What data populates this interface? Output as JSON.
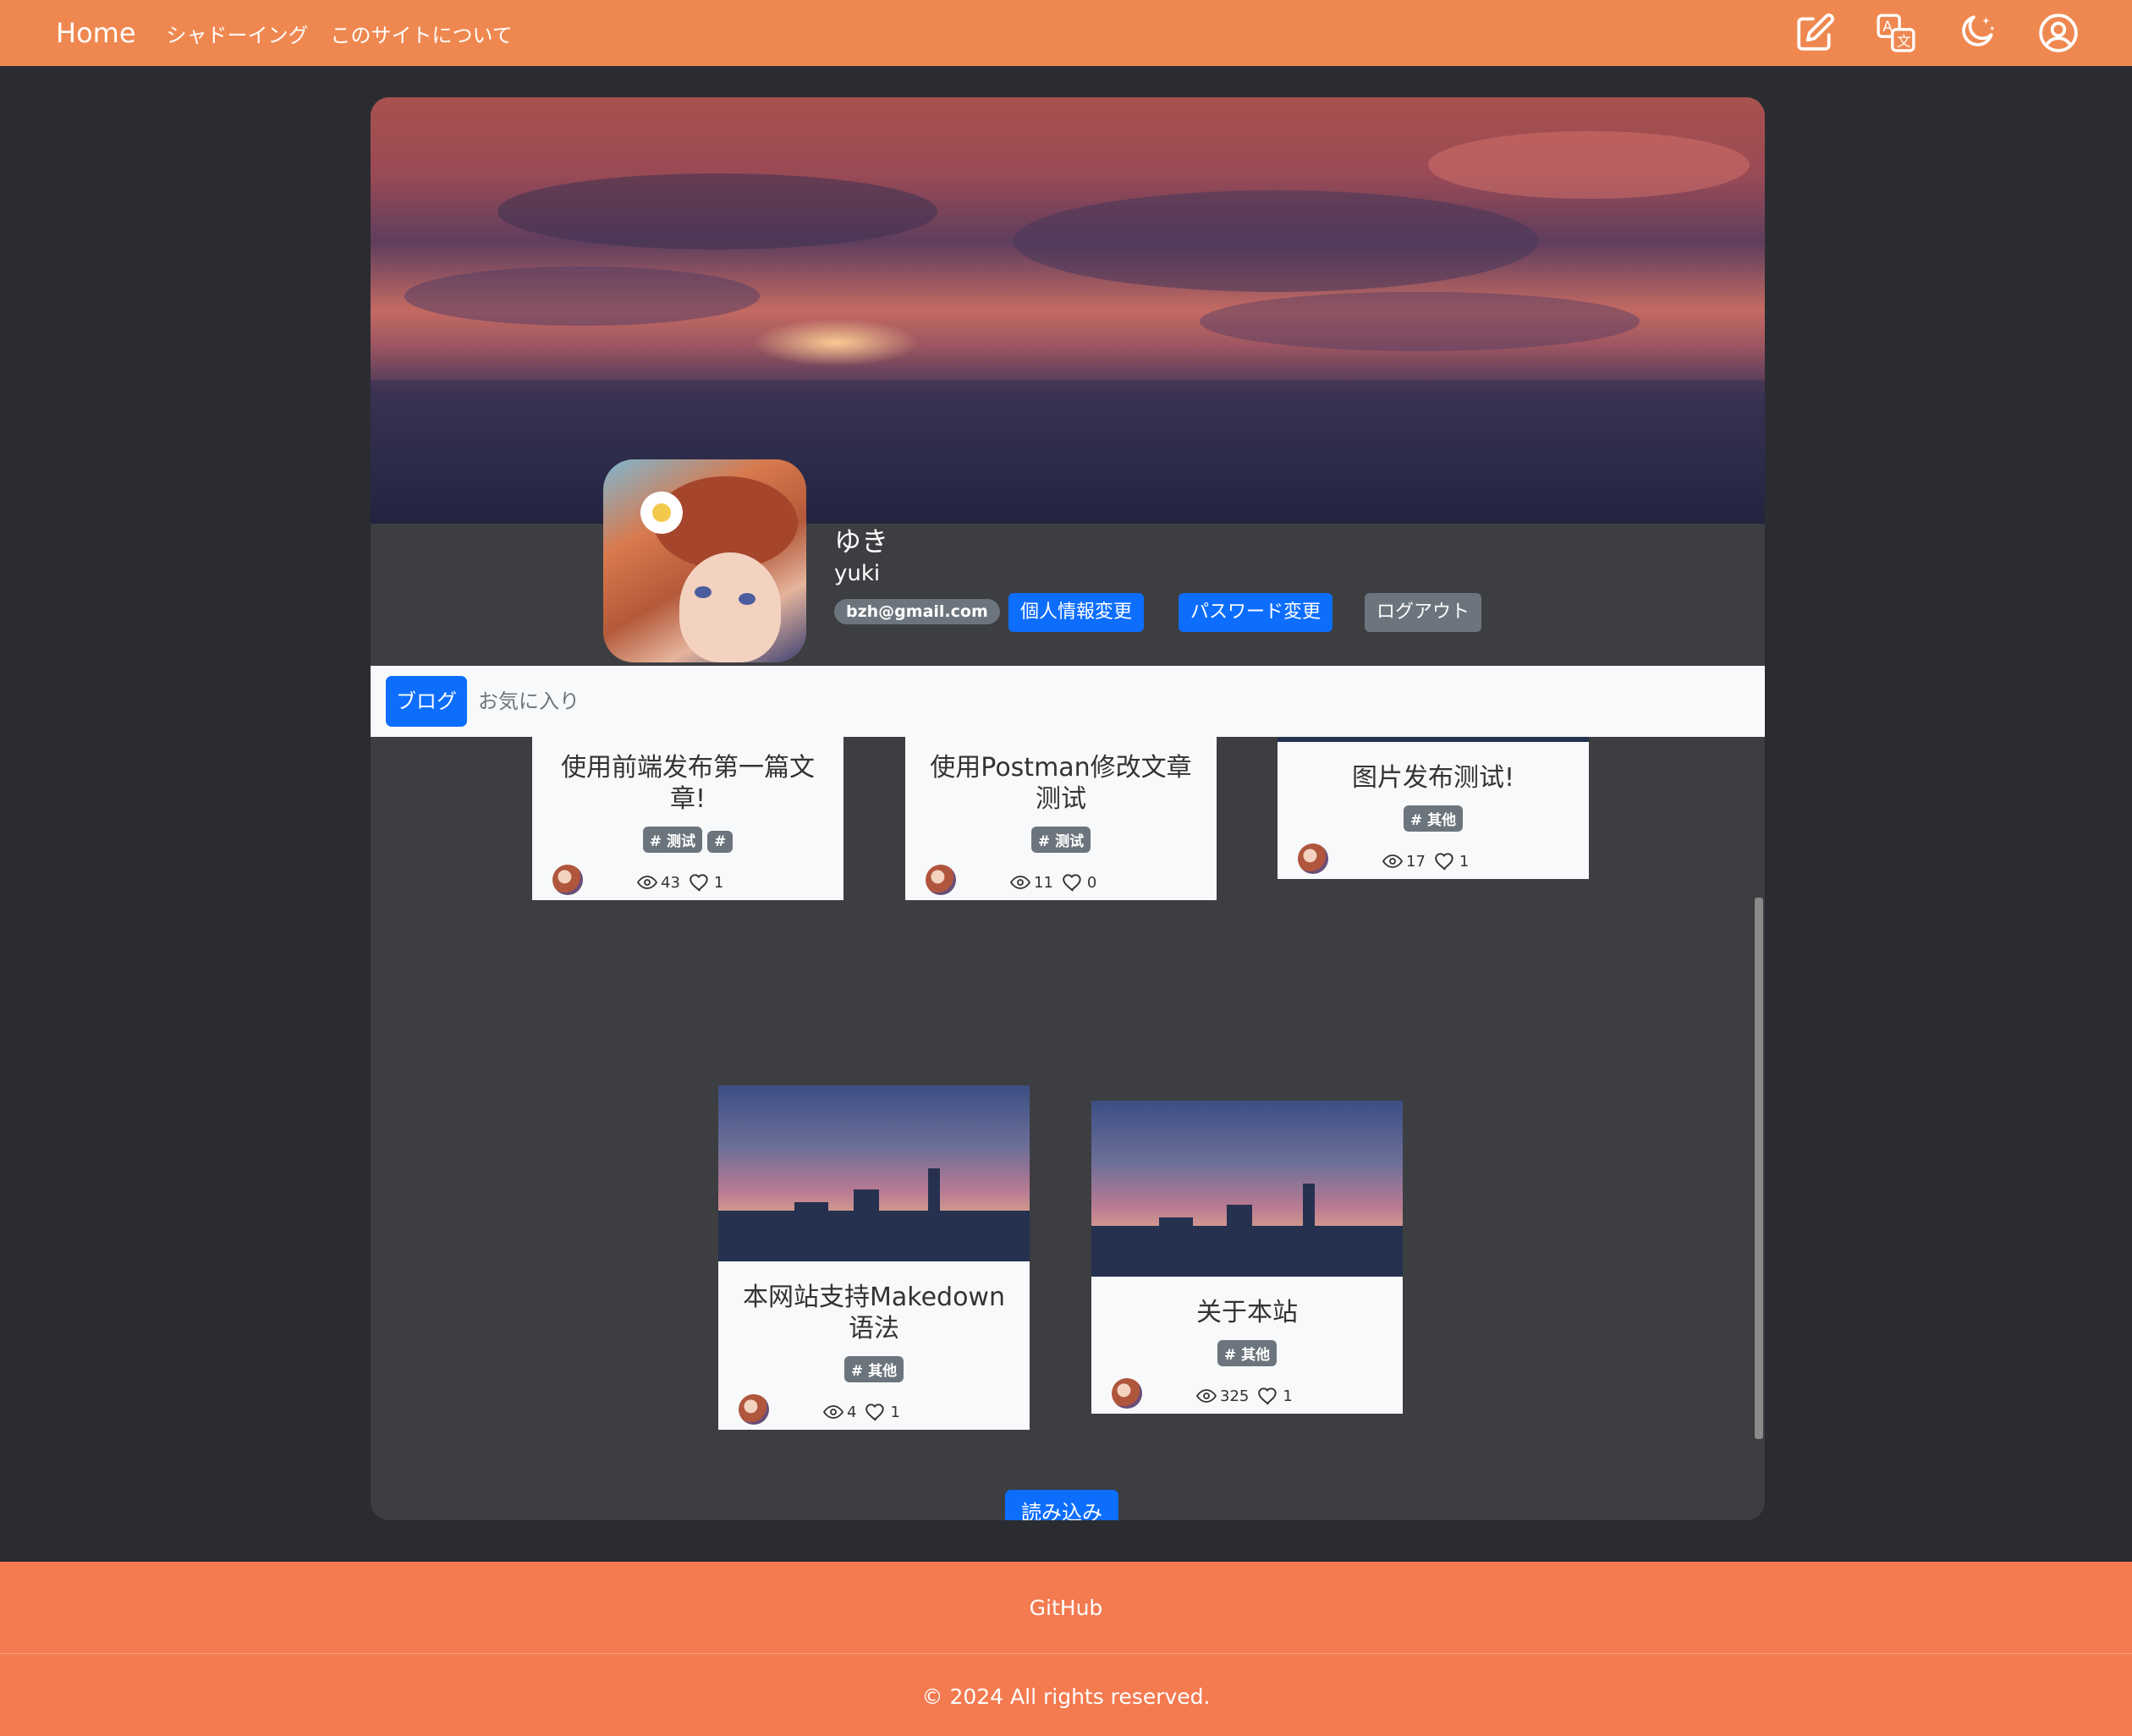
{
  "nav": {
    "brand": "Home",
    "links": [
      "シャドーイング",
      "このサイトについて"
    ],
    "icons": [
      "edit-icon",
      "translate-icon",
      "dark-mode-icon",
      "account-icon"
    ]
  },
  "profile": {
    "name": "ゆき",
    "username": "yuki",
    "email": "bzh@gmail.com",
    "buttons": {
      "edit_info": "個人情報変更",
      "change_password": "パスワード変更",
      "logout": "ログアウト"
    }
  },
  "tabs": {
    "blog": "ブログ",
    "favorites": "お気に入り"
  },
  "posts": [
    {
      "title": "使用前端发布第一篇文章!",
      "tags": [
        "# 测试",
        "#"
      ],
      "views": "43",
      "likes": "1"
    },
    {
      "title": "使用Postman修改文章测试",
      "tags": [
        "# 测试"
      ],
      "views": "11",
      "likes": "0"
    },
    {
      "title": "图片发布测试!",
      "tags": [
        "# 其他"
      ],
      "views": "17",
      "likes": "1"
    },
    {
      "title": "本网站支持Makedown语法",
      "tags": [
        "# 其他"
      ],
      "views": "4",
      "likes": "1"
    },
    {
      "title": "关于本站",
      "tags": [
        "# 其他"
      ],
      "views": "325",
      "likes": "1"
    }
  ],
  "load_more": "読み込み",
  "footer": {
    "link": "GitHub",
    "copyright": "© 2024 All rights reserved."
  },
  "colors": {
    "navbar": "#ef8850",
    "footer": "#f47a50",
    "primary": "#0d6efd",
    "secondary": "#6c757d",
    "background": "#2b2c31",
    "card": "#3d3e41"
  }
}
